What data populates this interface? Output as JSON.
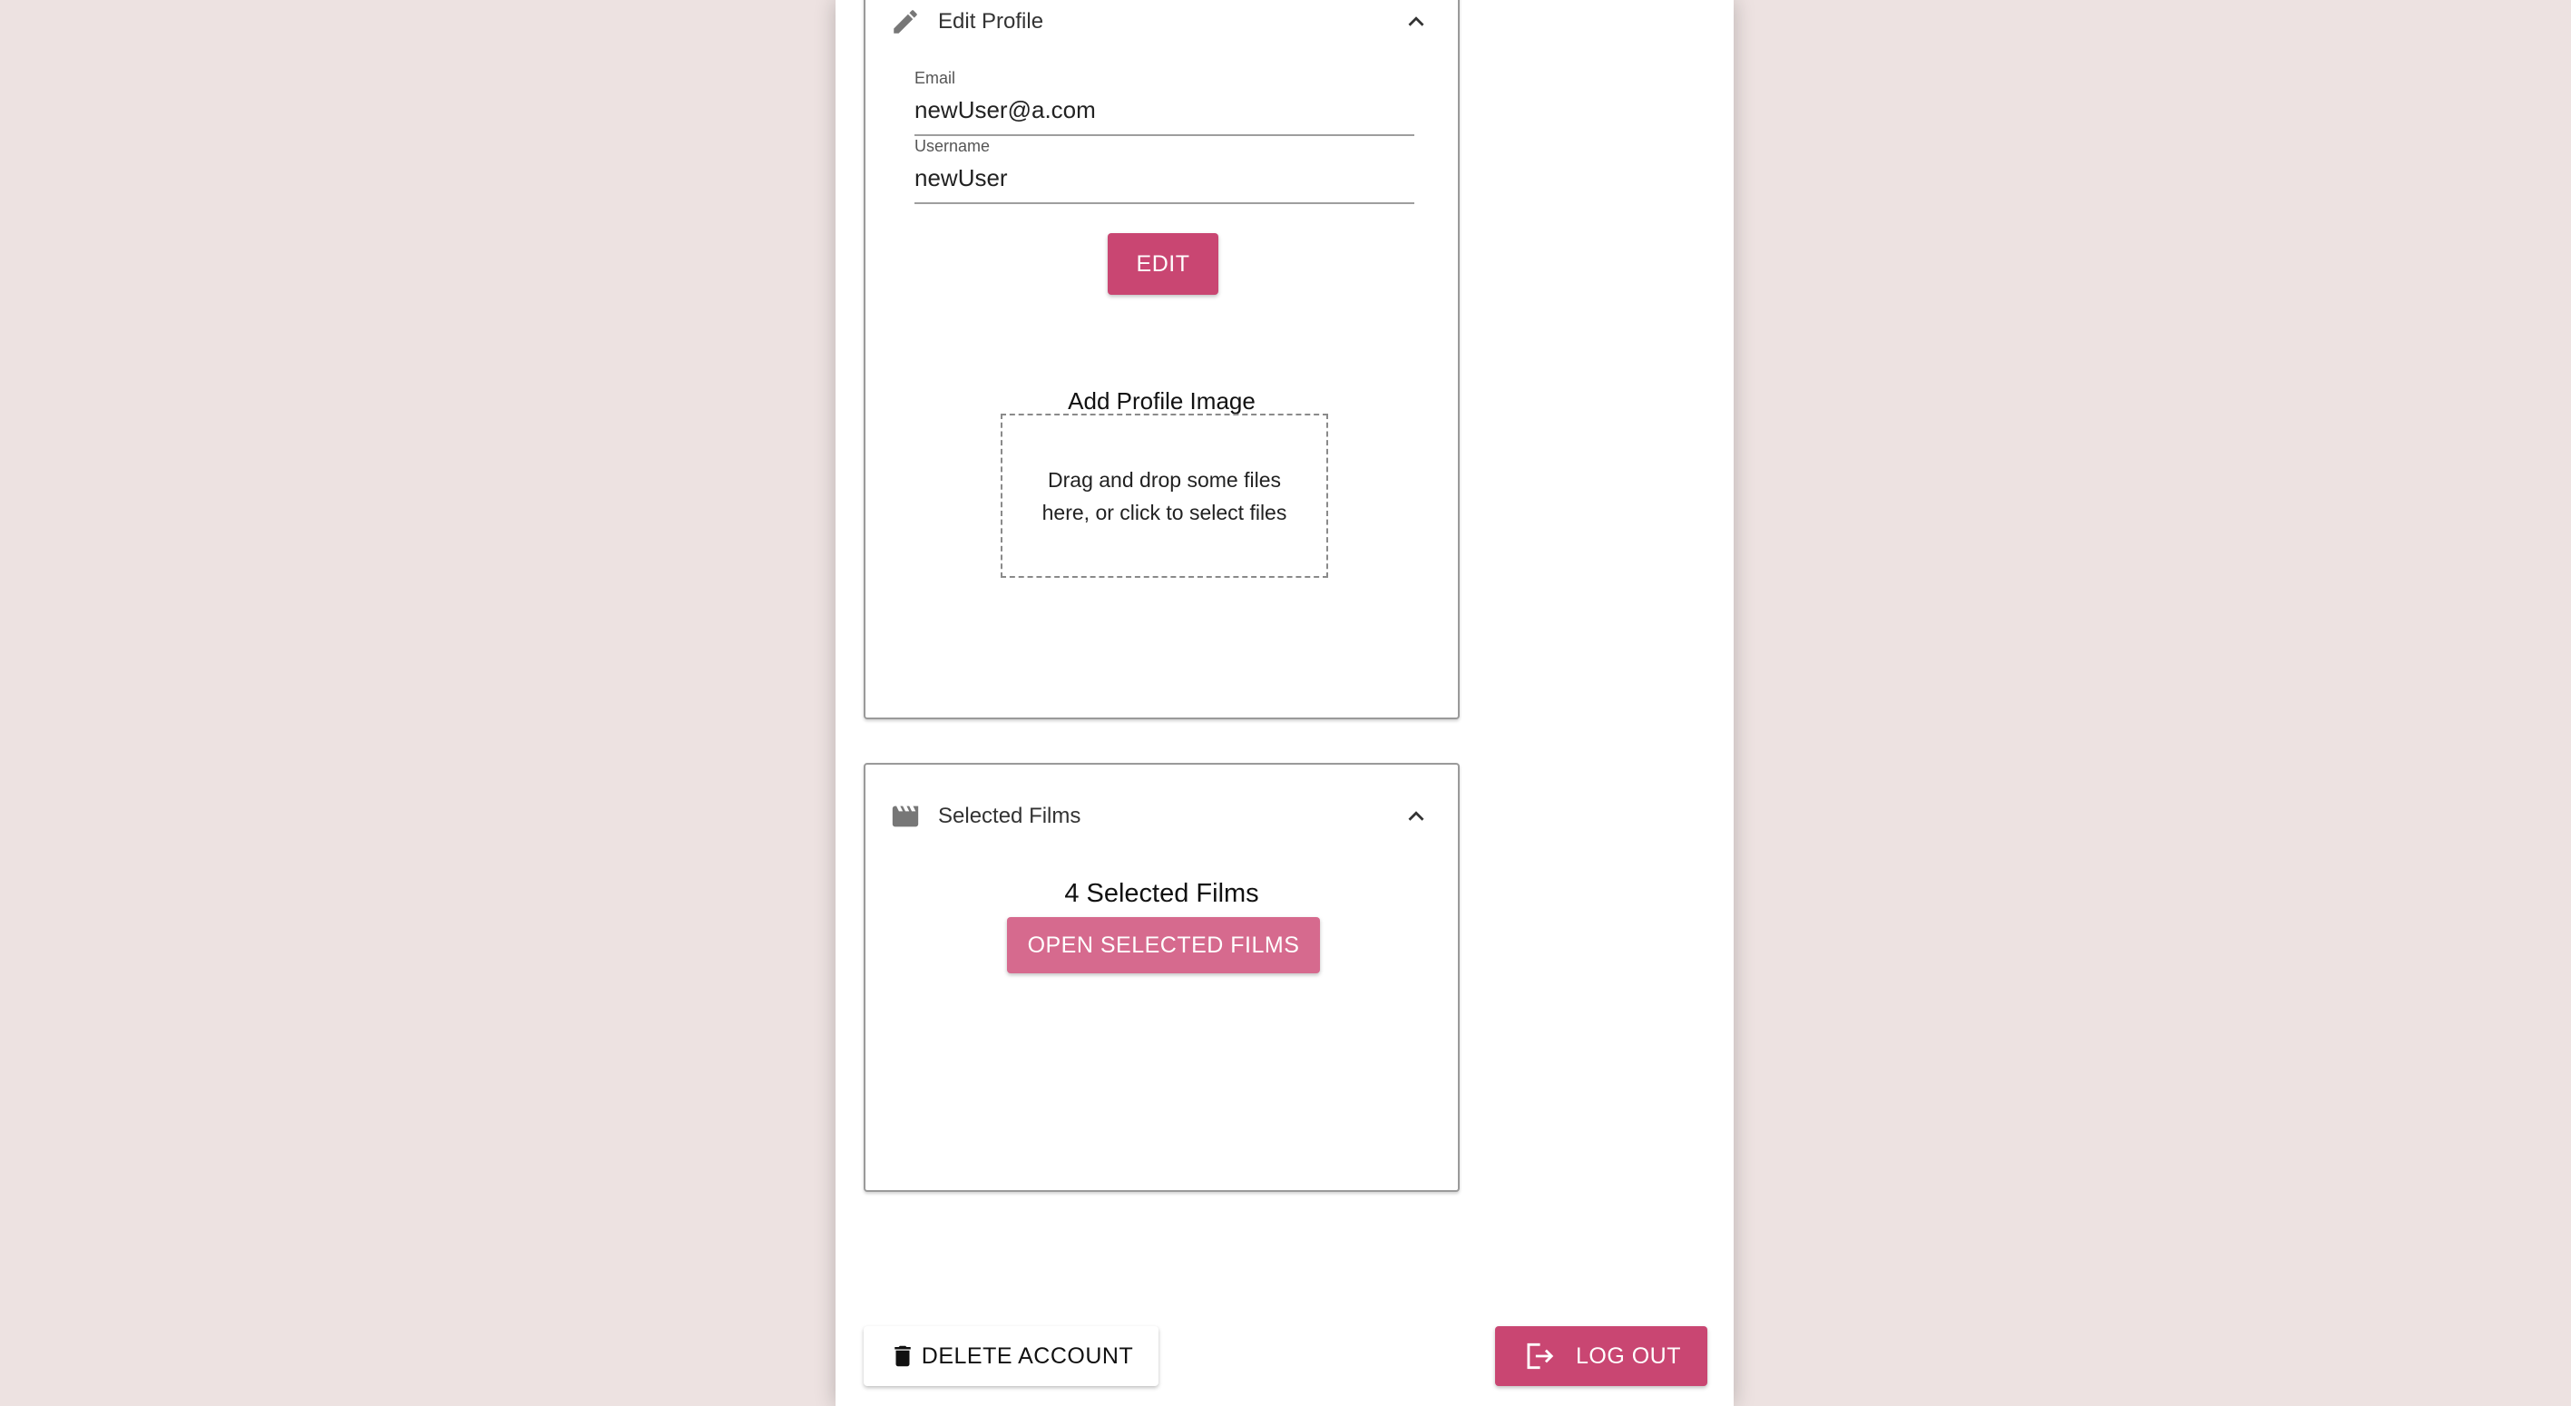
{
  "edit_profile": {
    "title": "Edit Profile",
    "icon": "pencil-icon",
    "email": {
      "label": "Email",
      "value": "newUser@a.com"
    },
    "username": {
      "label": "Username",
      "value": "newUser"
    },
    "edit_button": "EDIT",
    "upload": {
      "title": "Add Profile Image",
      "dropzone_text": "Drag and drop some files here, or click to select files"
    }
  },
  "selected_films": {
    "title": "Selected Films",
    "icon": "clapperboard-icon",
    "count_text": "4 Selected Films",
    "open_button": "OPEN SELECTED FILMS"
  },
  "footer": {
    "delete_button": "DELETE ACCOUNT",
    "logout_button": "LOG OUT"
  },
  "colors": {
    "background": "#ede2e1",
    "primary": "#c94672",
    "primary_light": "#d66a8e"
  }
}
